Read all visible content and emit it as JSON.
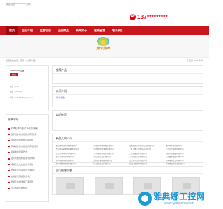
{
  "header": {
    "welcome": "欢迎您的**********公司",
    "phone_icon": "phone-icon",
    "phone": "137*********",
    "accent": "#c8161d"
  },
  "nav": [
    {
      "label": "首页",
      "active": true
    },
    {
      "label": "企业介绍",
      "active": false
    },
    {
      "label": "主营项目",
      "active": false
    },
    {
      "label": "企业商品",
      "active": false
    },
    {
      "label": "新闻中心",
      "active": false
    },
    {
      "label": "在线留言",
      "active": false
    },
    {
      "label": "联系我们",
      "active": false
    }
  ],
  "logo": {
    "text": "爱无国界"
  },
  "breadcrumb": "您现在的位置：首页 > 公司介绍",
  "date": "今天是 2025年8月",
  "profile": {
    "company_name": "**********公司",
    "tag": "信息",
    "lines": [
      "电话：0797*******",
      "地址：**********",
      "邮箱：1234567890@qq.com"
    ]
  },
  "news": {
    "title": "新闻中心",
    "items": [
      "FOB和CIF价格有什么区别和联系",
      "数字贸易中对外贸易的风险管理",
      "国际贸易中用到的几种标准",
      "环球贸易中对外贸易的风险和管理",
      "跨境电商的运营方式",
      "银行托收在国际贸易中的作用",
      "哪些汇款方式比较安全可靠",
      "外贸业务员应该如何开发客户",
      "如何提升国际贸易竞争力",
      "外贸企业如何规避汇率风险",
      "出口退税的主要流程"
    ]
  },
  "sections": {
    "products_title": "推荐产品",
    "about_title": "公司介绍",
    "about_more": "[查看详细]",
    "goods_title": "商机推荐",
    "new_companies_title": "新加入的公司",
    "interest_title": "您可能感兴趣"
  },
  "companies": [
    "重庆市区创新科技有限公司",
    "广州国际文化传媒有限公司",
    "西藏大运山水创意投资有限公司",
    "惠州市开发有限公司",
    "台州市东盛精密机械有限公司",
    "广州市新思路文化有限公司",
    "上海飞驰五金制造有限公司",
    "江苏艾比科技有限公司",
    "长沙市环兴电力有限公司",
    "广东中鑫信息技术有限公司",
    "上海三诚通泰有限公司",
    "合肥华达纺织有限公司",
    "上海江河科技有限公司",
    "广州江南开发有限公司",
    "上海创意实业有限公司",
    "江苏雅丰纺织有限公司",
    "苏州明达科技有限公司",
    "无锡市乐美科技有限公司",
    "浙江天宇信息有限公司",
    "上海东泰化工有限公司",
    "天津市博纳科技有限公司",
    "南京远大贸易有限公司",
    "重庆广源建材有限公司",
    "深圳市云峰实业有限公司",
    "北京鼎盛科技有限公司",
    "佛山市名豪家具有限公司",
    "杭州瑞丰贸易有限公司",
    "辽宁振兴机械有限公司"
  ],
  "interest": [
    {
      "id": 1
    },
    {
      "id": 2
    },
    {
      "id": 3
    },
    {
      "id": 4
    }
  ],
  "watermark": {
    "title": "雅典娜工控网",
    "url": "www.yadianna.com",
    "color": "#1a9ad7"
  }
}
